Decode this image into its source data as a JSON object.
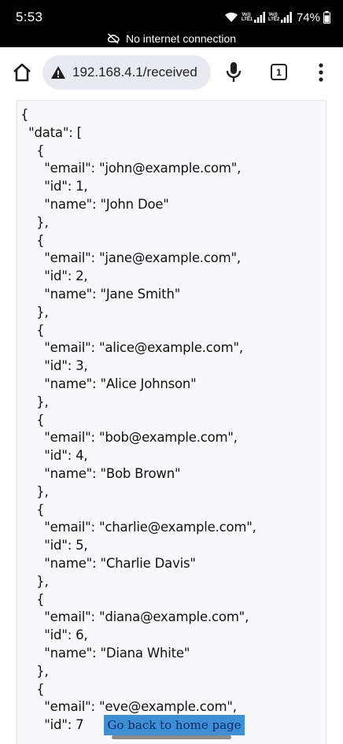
{
  "status_bar": {
    "time": "5:53",
    "sim1_label": "Vo)) LTE1",
    "sim2_label": "Vo)) LTE2",
    "battery_percent": "74%",
    "network_notice": "No internet connection"
  },
  "toolbar": {
    "url": "192.168.4.1/received",
    "tab_count": "1",
    "icons": [
      "home-icon",
      "warning-icon",
      "mic-icon",
      "tabs-icon",
      "more-vert-icon"
    ]
  },
  "page": {
    "json_lines": [
      "{",
      "  \"data\": [",
      "    {",
      "      \"email\": \"john@example.com\",",
      "      \"id\": 1,",
      "      \"name\": \"John Doe\"",
      "    },",
      "    {",
      "      \"email\": \"jane@example.com\",",
      "      \"id\": 2,",
      "      \"name\": \"Jane Smith\"",
      "    },",
      "    {",
      "      \"email\": \"alice@example.com\",",
      "      \"id\": 3,",
      "      \"name\": \"Alice Johnson\"",
      "    },",
      "    {",
      "      \"email\": \"bob@example.com\",",
      "      \"id\": 4,",
      "      \"name\": \"Bob Brown\"",
      "    },",
      "    {",
      "      \"email\": \"charlie@example.com\",",
      "      \"id\": 5,",
      "      \"name\": \"Charlie Davis\"",
      "    },",
      "    {",
      "      \"email\": \"diana@example.com\",",
      "      \"id\": 6,",
      "      \"name\": \"Diana White\"",
      "    },",
      "    {",
      "      \"email\": \"eve@example.com\",",
      "      \"id\": 7"
    ],
    "back_button_label": "Go back to home page"
  },
  "colors": {
    "status_bar_bg": "#000000",
    "url_pill_bg": "#e8eaf0",
    "json_box_bg": "#f8f8fa",
    "back_button_bg": "#3f8fd6",
    "back_button_text": "#0a2a66"
  }
}
